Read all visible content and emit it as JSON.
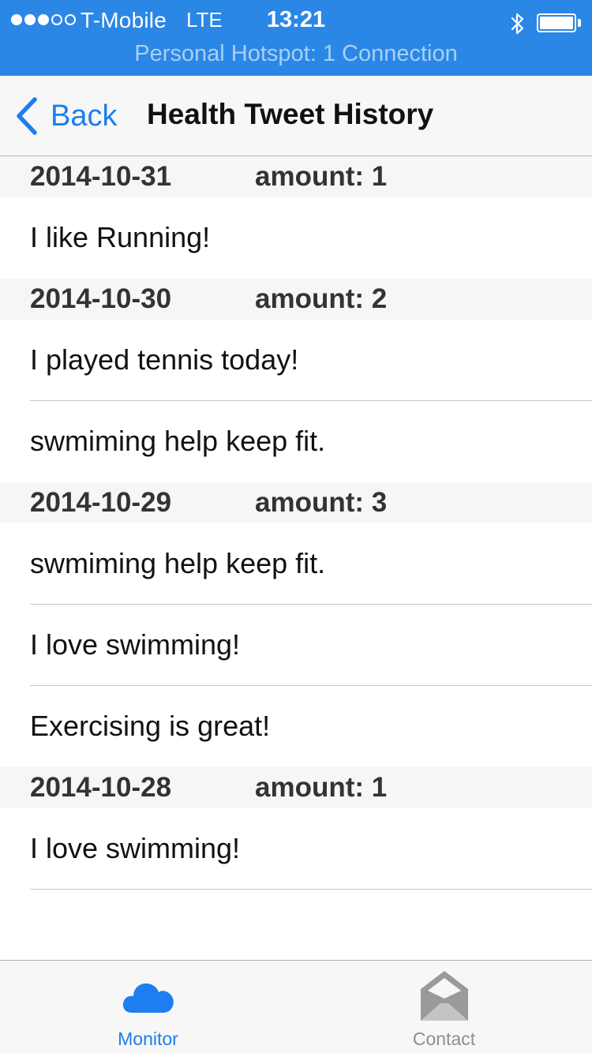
{
  "status_bar": {
    "carrier": "T-Mobile",
    "network": "LTE",
    "time": "13:21",
    "hotspot": "Personal Hotspot: 1 Connection",
    "signal_bars_filled": 3,
    "signal_bars_total": 5,
    "battery_level": 1.0,
    "icons": {
      "bluetooth": "bluetooth-icon",
      "battery": "battery-icon"
    }
  },
  "nav": {
    "back_label": "Back",
    "back_icon": "chevron-left-icon",
    "title": "Health Tweet History"
  },
  "sections": [
    {
      "date": "2014-10-31",
      "amount": "amount: 1",
      "items": [
        "I like Running!"
      ]
    },
    {
      "date": "2014-10-30",
      "amount": "amount: 2",
      "items": [
        "I played tennis today!",
        "swmiming help keep fit."
      ]
    },
    {
      "date": "2014-10-29",
      "amount": "amount: 3",
      "items": [
        "swmiming help keep fit.",
        "I love swimming!",
        "Exercising is great!"
      ]
    },
    {
      "date": "2014-10-28",
      "amount": "amount: 1",
      "items": [
        "I love swimming!"
      ]
    }
  ],
  "tabs": [
    {
      "label": "Monitor",
      "icon": "cloud-icon",
      "selected": true
    },
    {
      "label": "Contact",
      "icon": "envelope-icon",
      "selected": false
    }
  ],
  "colors": {
    "accent": "#1c7ef0",
    "status_bar": "#2a87e6",
    "tab_inactive": "#8e8e8e"
  }
}
